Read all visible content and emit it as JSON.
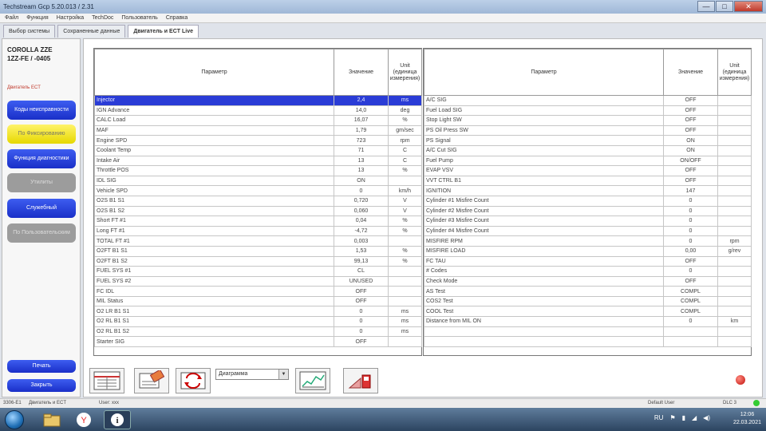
{
  "window": {
    "title": "Techstream Gcp 5.20.013 / 2.31",
    "buttons": [
      "—",
      "□",
      "✕"
    ]
  },
  "menu": [
    "Файл",
    "Функция",
    "Настройка",
    "TechDoc",
    "Пользователь",
    "Справка"
  ],
  "tabs": [
    "Выбор системы",
    "Сохраненные данные",
    "Двигатель и ECT Live"
  ],
  "vehicle": {
    "line1": "COROLLA ZZE",
    "line2": "1ZZ-FE / -0405",
    "note": "Двигатель ECT"
  },
  "sidebar": {
    "buttons": [
      "Коды неисправности",
      "По Фиксированию",
      "Функция диагностики",
      "Утилиты",
      "Служебный",
      "По Пользовательским"
    ],
    "bottom": [
      "Печать",
      "Закрыть"
    ]
  },
  "table": {
    "headers": {
      "param": "Параметр",
      "value": "Значение",
      "unit": "Unit (единица измерения)"
    },
    "left": [
      [
        "Injector",
        "2,4",
        "ms"
      ],
      [
        "IGN Advance",
        "14,0",
        "deg"
      ],
      [
        "CALC Load",
        "16,07",
        "%"
      ],
      [
        "MAF",
        "1,79",
        "gm/sec"
      ],
      [
        "Engine SPD",
        "723",
        "rpm"
      ],
      [
        "Coolant Temp",
        "71",
        "C"
      ],
      [
        "Intake Air",
        "13",
        "C"
      ],
      [
        "Throttle POS",
        "13",
        "%"
      ],
      [
        "IDL SIG",
        "ON",
        ""
      ],
      [
        "Vehicle SPD",
        "0",
        "km/h"
      ],
      [
        "O2S B1 S1",
        "0,720",
        "V"
      ],
      [
        "O2S B1 S2",
        "0,060",
        "V"
      ],
      [
        "Short FT #1",
        "0,04",
        "%"
      ],
      [
        "Long FT #1",
        "-4,72",
        "%"
      ],
      [
        "TOTAL FT #1",
        "0,003",
        ""
      ],
      [
        "O2FT B1 S1",
        "1,53",
        "%"
      ],
      [
        "O2FT B1 S2",
        "99,13",
        "%"
      ],
      [
        "FUEL SYS #1",
        "CL",
        ""
      ],
      [
        "FUEL SYS #2",
        "UNUSED",
        ""
      ],
      [
        "FC IDL",
        "OFF",
        ""
      ],
      [
        "MIL Status",
        "OFF",
        ""
      ],
      [
        "O2 LR B1 S1",
        "0",
        "ms"
      ],
      [
        "O2 RL B1 S1",
        "0",
        "ms"
      ],
      [
        "O2 RL B1 S2",
        "0",
        "ms"
      ],
      [
        "Starter SIG",
        "OFF",
        ""
      ]
    ],
    "right": [
      [
        "A/C SIG",
        "OFF",
        ""
      ],
      [
        "Fuel Load SIG",
        "OFF",
        ""
      ],
      [
        "Stop Light SW",
        "OFF",
        ""
      ],
      [
        "PS Oil Press SW",
        "OFF",
        ""
      ],
      [
        "PS Signal",
        "ON",
        ""
      ],
      [
        "A/C Cut SIG",
        "ON",
        ""
      ],
      [
        "Fuel Pump",
        "ON/OFF",
        ""
      ],
      [
        "EVAP VSV",
        "OFF",
        ""
      ],
      [
        "VVT CTRL B1",
        "OFF",
        ""
      ],
      [
        "IGNITION",
        "147",
        ""
      ],
      [
        "Cylinder #1 Misfire Count",
        "0",
        ""
      ],
      [
        "Cylinder #2 Misfire Count",
        "0",
        ""
      ],
      [
        "Cylinder #3 Misfire Count",
        "0",
        ""
      ],
      [
        "Cylinder #4 Misfire Count",
        "0",
        ""
      ],
      [
        "MISFIRE RPM",
        "0",
        "rpm"
      ],
      [
        "MISFIRE LOAD",
        "0,00",
        "g/rev"
      ],
      [
        "FC TAU",
        "OFF",
        ""
      ],
      [
        "# Codes",
        "0",
        ""
      ],
      [
        "Check Mode",
        "OFF",
        ""
      ],
      [
        "AS Test",
        "COMPL",
        ""
      ],
      [
        "COS2 Test",
        "COMPL",
        ""
      ],
      [
        "COOL Test",
        "COMPL",
        ""
      ],
      [
        "Distance from MIL ON",
        "0",
        "km"
      ]
    ]
  },
  "toolbar": {
    "select_value": "Диаграмма"
  },
  "status": {
    "left": "3306-E1",
    "mid": "Двигатель и ECT",
    "user": "User: xxx",
    "right1": "Default User",
    "right2": "DLC 3"
  },
  "taskbar": {
    "time": "12:06",
    "date": "22.03.2021",
    "lang": "RU"
  }
}
